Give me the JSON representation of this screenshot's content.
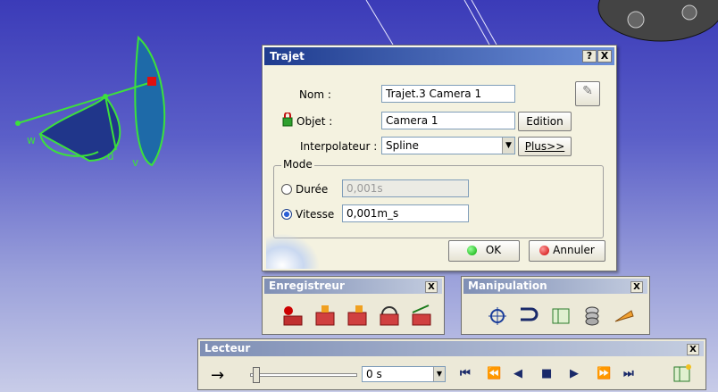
{
  "dialog": {
    "title": "Trajet",
    "help_btn": "?",
    "close_btn": "X",
    "nom_label": "Nom :",
    "nom_value": "Trajet.3 Camera  1",
    "objet_label": "Objet :",
    "objet_value": "Camera  1",
    "edition_btn": "Edition",
    "interp_label": "Interpolateur :",
    "interp_value": "Spline",
    "plus_btn": "Plus>>",
    "mode_label": "Mode",
    "duree_label": "Durée",
    "duree_value": "0,001s",
    "vitesse_label": "Vitesse",
    "vitesse_value": "0,001m_s",
    "ok_btn": "OK",
    "annuler_btn": "Annuler"
  },
  "axes": {
    "w": "w",
    "u": "u",
    "v": "v"
  },
  "enregistreur": {
    "title": "Enregistreur",
    "close": "X"
  },
  "manipulation": {
    "title": "Manipulation",
    "close": "X"
  },
  "lecteur": {
    "title": "Lecteur",
    "close": "X",
    "time_value": "0 s"
  },
  "colors": {
    "accent": "#1f3c8f",
    "green": "#2ee02e",
    "red": "#e01010"
  }
}
